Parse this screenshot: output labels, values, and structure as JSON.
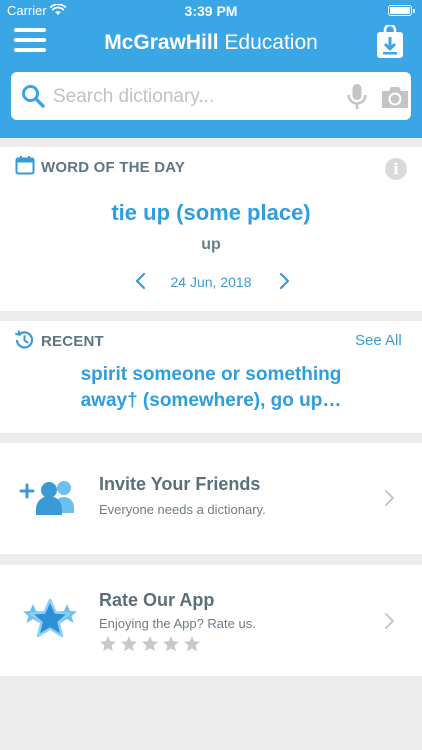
{
  "status_bar": {
    "carrier": "Carrier",
    "time": "3:39 PM"
  },
  "header": {
    "brand_bold": "McGrawHill",
    "brand_regular": " Education"
  },
  "search": {
    "placeholder": "Search dictionary..."
  },
  "word_of_the_day": {
    "section_title": "WORD OF THE DAY",
    "word": "tie up (some place)",
    "subtext": "up",
    "date": "24 Jun, 2018"
  },
  "recent": {
    "section_title": "RECENT",
    "see_all": "See All",
    "entry_line1": "spirit someone or something",
    "entry_line2": "away† (somewhere), go up…"
  },
  "invite": {
    "title": "Invite Your Friends",
    "subtitle": "Everyone needs a dictionary."
  },
  "rate": {
    "title": "Rate Our App",
    "subtitle": "Enjoying the App? Rate us.",
    "rating": 0,
    "max_rating": 5
  },
  "colors": {
    "header_blue": "#3aa6e6",
    "link_blue": "#2d9ee0",
    "gray_text": "#5e7584",
    "background": "#ececec"
  },
  "icons": [
    "wifi-icon",
    "battery-icon",
    "menu-icon",
    "download-bag-icon",
    "search-icon",
    "microphone-icon",
    "camera-icon",
    "calendar-icon",
    "info-icon",
    "chevron-left-icon",
    "chevron-right-icon",
    "history-icon",
    "add-friends-icon",
    "star-badge-icon",
    "star-icon"
  ]
}
